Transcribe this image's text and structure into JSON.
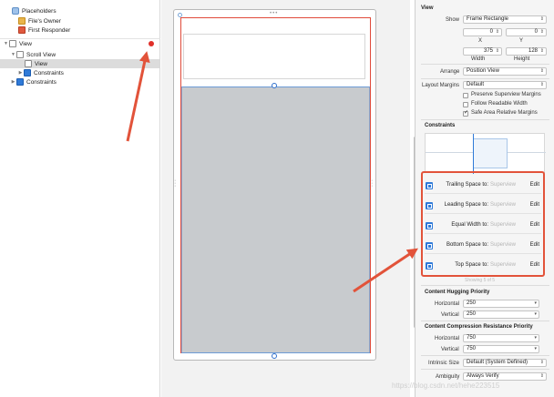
{
  "outline": {
    "items": [
      {
        "label": "Placeholders",
        "icon": "placeholder-icon",
        "indent": 0,
        "tri": ""
      },
      {
        "label": "File's Owner",
        "icon": "cube-yellow-icon",
        "indent": 1,
        "tri": ""
      },
      {
        "label": "First Responder",
        "icon": "cube-red-icon",
        "indent": 1,
        "tri": ""
      },
      {
        "label": "View",
        "icon": "view-icon",
        "indent": 0,
        "tri": "▼"
      },
      {
        "label": "Scroll View",
        "icon": "view-icon",
        "indent": 1,
        "tri": "▼"
      },
      {
        "label": "View",
        "icon": "view-icon",
        "indent": 2,
        "tri": "",
        "selected": true
      },
      {
        "label": "Constraints",
        "icon": "constraints-icon",
        "indent": 2,
        "tri": "▶"
      },
      {
        "label": "Constraints",
        "icon": "constraints-icon",
        "indent": 1,
        "tri": "▶"
      }
    ]
  },
  "canvas": {
    "gray_view_label": "",
    "top_dots": "•••"
  },
  "inspector": {
    "section_view": "View",
    "show_label": "Show",
    "show_value": "Frame Rectangle",
    "x_value": "0",
    "y_value": "0",
    "x_label": "X",
    "y_label": "Y",
    "width_value": "375",
    "height_value": "128",
    "width_label": "Width",
    "height_label": "Height",
    "arrange_label": "Arrange",
    "arrange_value": "Position View",
    "layout_margins_label": "Layout Margins",
    "layout_margins_value": "Default",
    "preserve_superview": "Preserve Superview Margins",
    "follow_readable": "Follow Readable Width",
    "safe_area": "Safe Area Relative Margins",
    "constraints_title": "Constraints",
    "constraints": [
      {
        "label": "Trailing Space to:",
        "target": "Superview",
        "edit": "Edit"
      },
      {
        "label": "Leading Space to:",
        "target": "Superview",
        "edit": "Edit"
      },
      {
        "label": "Equal Width to:",
        "target": "Superview",
        "edit": "Edit"
      },
      {
        "label": "Bottom Space to:",
        "target": "Superview",
        "edit": "Edit"
      },
      {
        "label": "Top Space to:",
        "target": "Superview",
        "edit": "Edit"
      }
    ],
    "showing": "Showing 5 of 5",
    "hugging_title": "Content Hugging Priority",
    "horizontal_label": "Horizontal",
    "vertical_label": "Vertical",
    "hug_h": "250",
    "hug_v": "250",
    "compression_title": "Content Compression Resistance Priority",
    "comp_h": "750",
    "comp_v": "750",
    "intrinsic_label": "Intrinsic Size",
    "intrinsic_value": "Default (System Defined)",
    "ambiguity_label": "Ambiguity",
    "ambiguity_value": "Always Verify"
  },
  "watermark": "https://blog.csdn.net/hehe223515",
  "colors": {
    "accent": "#2f7ad8",
    "annotation": "#e2533a",
    "error": "#e0302a"
  }
}
